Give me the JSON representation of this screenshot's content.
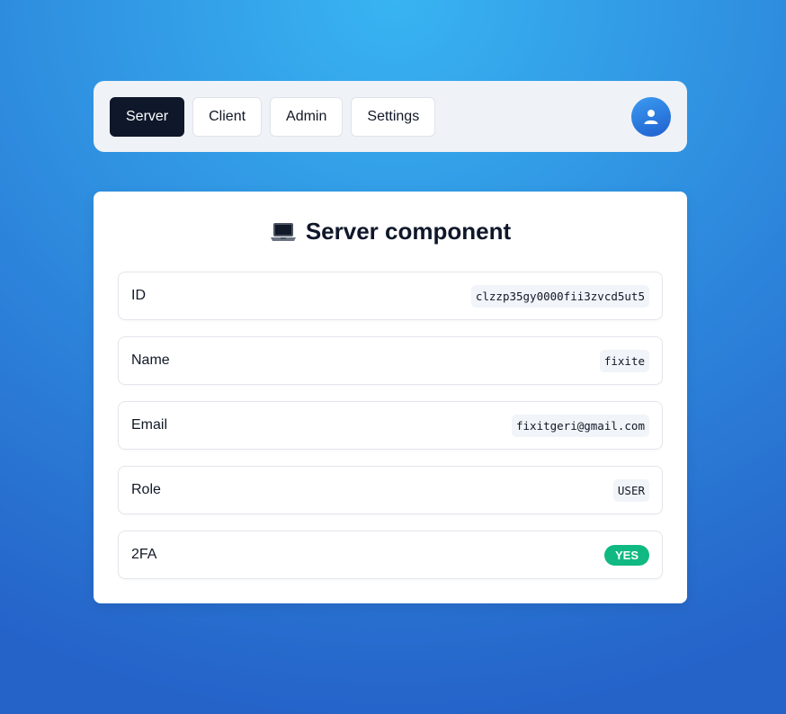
{
  "nav": {
    "tabs": [
      {
        "label": "Server",
        "active": true
      },
      {
        "label": "Client",
        "active": false
      },
      {
        "label": "Admin",
        "active": false
      },
      {
        "label": "Settings",
        "active": false
      }
    ],
    "avatar_icon": "user-icon"
  },
  "card": {
    "title_icon": "laptop-icon",
    "title": "Server component",
    "rows": [
      {
        "label": "ID",
        "value": "clzzp35gy0000fii3zvcd5ut5"
      },
      {
        "label": "Name",
        "value": "fixite"
      },
      {
        "label": "Email",
        "value": "fixitgeri@gmail.com"
      },
      {
        "label": "Role",
        "value": "USER"
      },
      {
        "label": "2FA",
        "value": "YES"
      }
    ]
  },
  "colors": {
    "active_tab": "#0f172a",
    "badge_green": "#10b981",
    "avatar_blue": "#2b7de2"
  }
}
